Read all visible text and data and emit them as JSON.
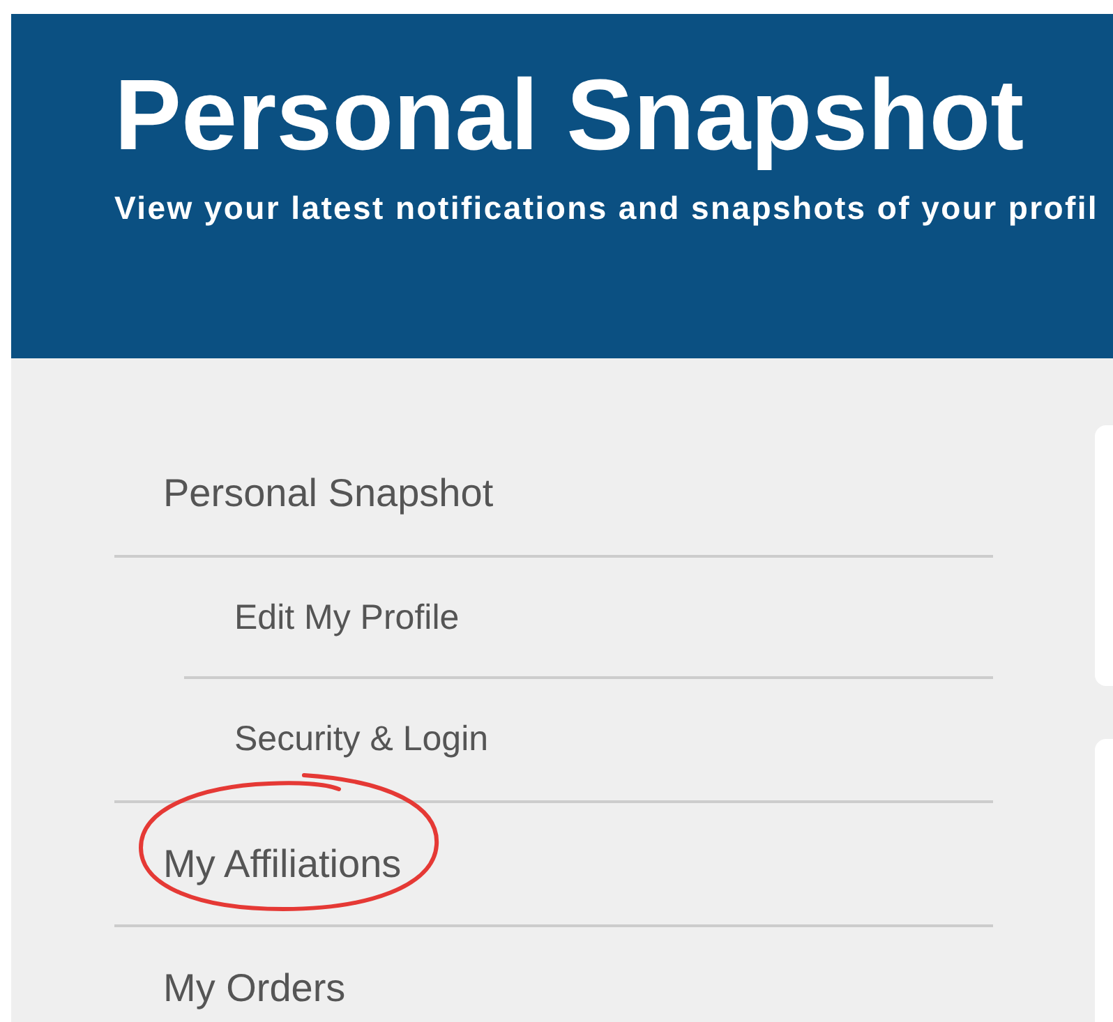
{
  "header": {
    "title": "Personal Snapshot",
    "subtitle": "View your latest notifications and snapshots of your profil"
  },
  "nav": {
    "items": [
      {
        "label": "Personal Snapshot",
        "highlighted": false,
        "children": [
          {
            "label": "Edit My Profile",
            "highlighted": false
          },
          {
            "label": "Security & Login",
            "highlighted": false
          }
        ]
      },
      {
        "label": "My Affiliations",
        "highlighted": true
      },
      {
        "label": "My Orders",
        "highlighted": false
      }
    ]
  }
}
